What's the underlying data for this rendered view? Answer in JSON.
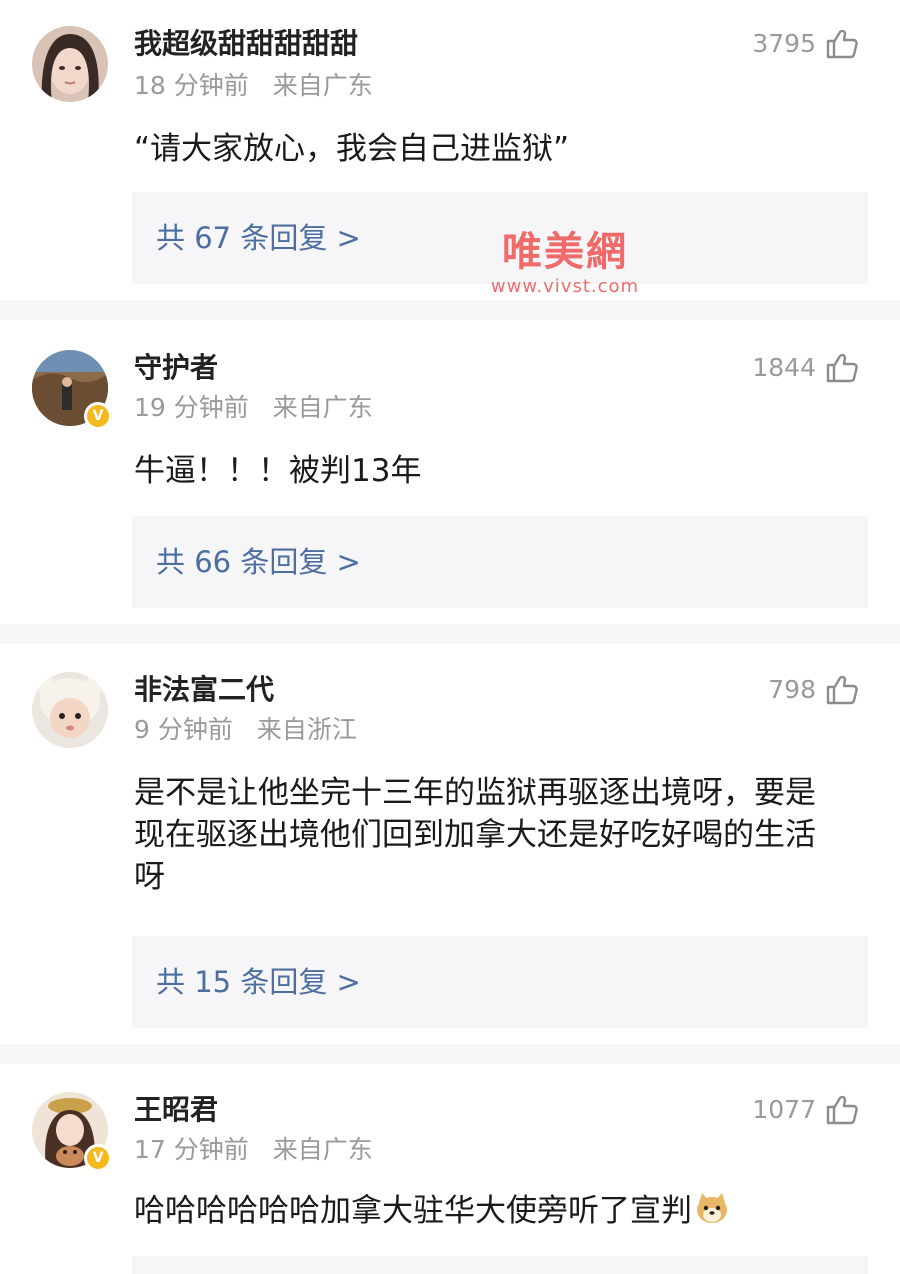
{
  "comments": [
    {
      "username": "我超级甜甜甜甜甜",
      "time": "18 分钟前",
      "location": "来自广东",
      "likes": "3795",
      "text": "“请大家放心，我会自己进监狱”",
      "replies": "共 67 条回复 >",
      "verified": false
    },
    {
      "username": "守护者",
      "time": "19 分钟前",
      "location": "来自广东",
      "likes": "1844",
      "text": "牛逼！！！被判13年",
      "replies": "共 66 条回复 >",
      "verified": true
    },
    {
      "username": "非法富二代",
      "time": "9 分钟前",
      "location": "来自浙江",
      "likes": "798",
      "text": "是不是让他坐完十三年的监狱再驱逐出境呀，要是现在驱逐出境他们回到加拿大还是好吃好喝的生活呀",
      "replies": "共 15 条回复 >",
      "verified": false
    },
    {
      "username": "王昭君",
      "time": "17 分钟前",
      "location": "来自广东",
      "likes": "1077",
      "text": "哈哈哈哈哈哈加拿大驻华大使旁听了宣判",
      "verified": true
    }
  ],
  "watermark": {
    "title": "唯美網",
    "url": "www.vivst.com"
  },
  "colors": {
    "reply_link": "#4d6fa0",
    "meta_text": "#9a9a9a",
    "reply_bg": "#f6f6f8",
    "verified_badge": "#f5b91e",
    "watermark": "#f06a6a"
  },
  "icons": {
    "like": "thumbs-up-outline-icon",
    "verified": "verified-v-badge-icon",
    "emoji": "doge-emoji-icon"
  }
}
